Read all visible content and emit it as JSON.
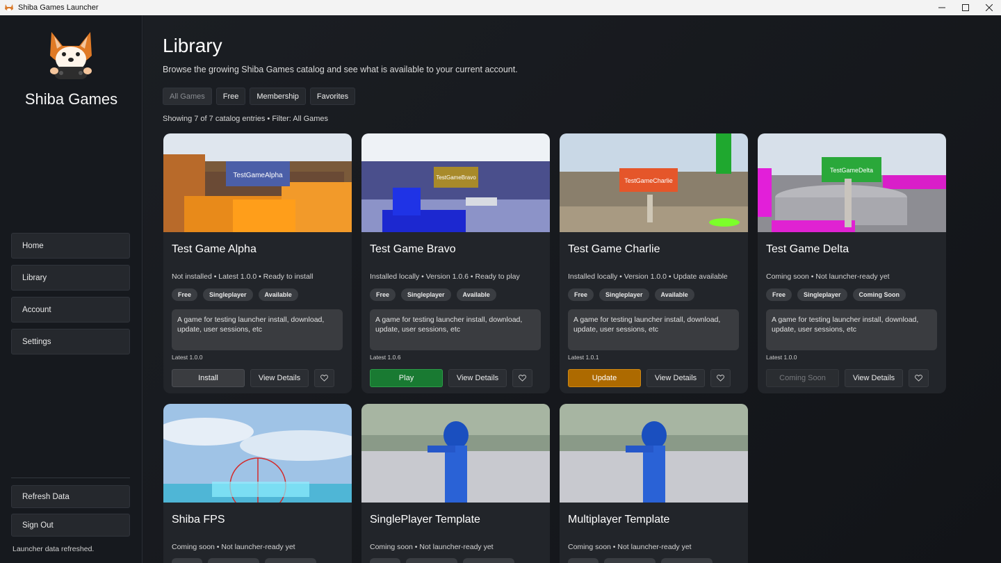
{
  "window": {
    "title": "Shiba Games Launcher"
  },
  "sidebar": {
    "brand": "Shiba Games",
    "nav": [
      {
        "label": "Home"
      },
      {
        "label": "Library"
      },
      {
        "label": "Account"
      },
      {
        "label": "Settings"
      }
    ],
    "refresh_label": "Refresh Data",
    "signout_label": "Sign Out",
    "status": "Launcher data refreshed."
  },
  "library": {
    "title": "Library",
    "subtitle": "Browse the growing Shiba Games catalog and see what is available to your current account.",
    "filters": [
      {
        "label": "All Games",
        "active": true
      },
      {
        "label": "Free"
      },
      {
        "label": "Membership"
      },
      {
        "label": "Favorites"
      }
    ],
    "showing": "Showing 7 of 7 catalog entries • Filter: All Games",
    "games": [
      {
        "title": "Test Game Alpha",
        "sign": "TestGameAlpha",
        "status": "Not installed • Latest 1.0.0 • Ready to install",
        "tags": [
          "Free",
          "Singleplayer",
          "Available"
        ],
        "description": "A game for testing launcher install, download, update, user sessions, etc",
        "latest": "Latest 1.0.0",
        "action": "Install",
        "details": "View Details"
      },
      {
        "title": "Test Game Bravo",
        "sign": "TestGameBravo",
        "status": "Installed locally • Version 1.0.6 • Ready to play",
        "tags": [
          "Free",
          "Singleplayer",
          "Available"
        ],
        "description": "A game for testing launcher install, download, update, user sessions, etc",
        "latest": "Latest 1.0.6",
        "action": "Play",
        "details": "View Details"
      },
      {
        "title": "Test Game Charlie",
        "sign": "TestGameCharlie",
        "status": "Installed locally • Version 1.0.0 • Update available",
        "tags": [
          "Free",
          "Singleplayer",
          "Available"
        ],
        "description": "A game for testing launcher install, download, update, user sessions, etc",
        "latest": "Latest 1.0.1",
        "action": "Update",
        "details": "View Details"
      },
      {
        "title": "Test Game Delta",
        "sign": "TestGameDelta",
        "status": "Coming soon • Not launcher-ready yet",
        "tags": [
          "Free",
          "Singleplayer",
          "Coming Soon"
        ],
        "description": "A game for testing launcher install, download, update, user sessions, etc",
        "latest": "Latest 1.0.0",
        "action": "Coming Soon",
        "details": "View Details"
      },
      {
        "title": "Shiba FPS",
        "status": "Coming soon • Not launcher-ready yet"
      },
      {
        "title": "SinglePlayer Template",
        "status": "Coming soon • Not launcher-ready yet"
      },
      {
        "title": "Multiplayer Template",
        "status": "Coming soon • Not launcher-ready yet"
      }
    ]
  },
  "colors": {
    "play": "#197a32",
    "update": "#ad6a00",
    "background": "#16191e"
  }
}
